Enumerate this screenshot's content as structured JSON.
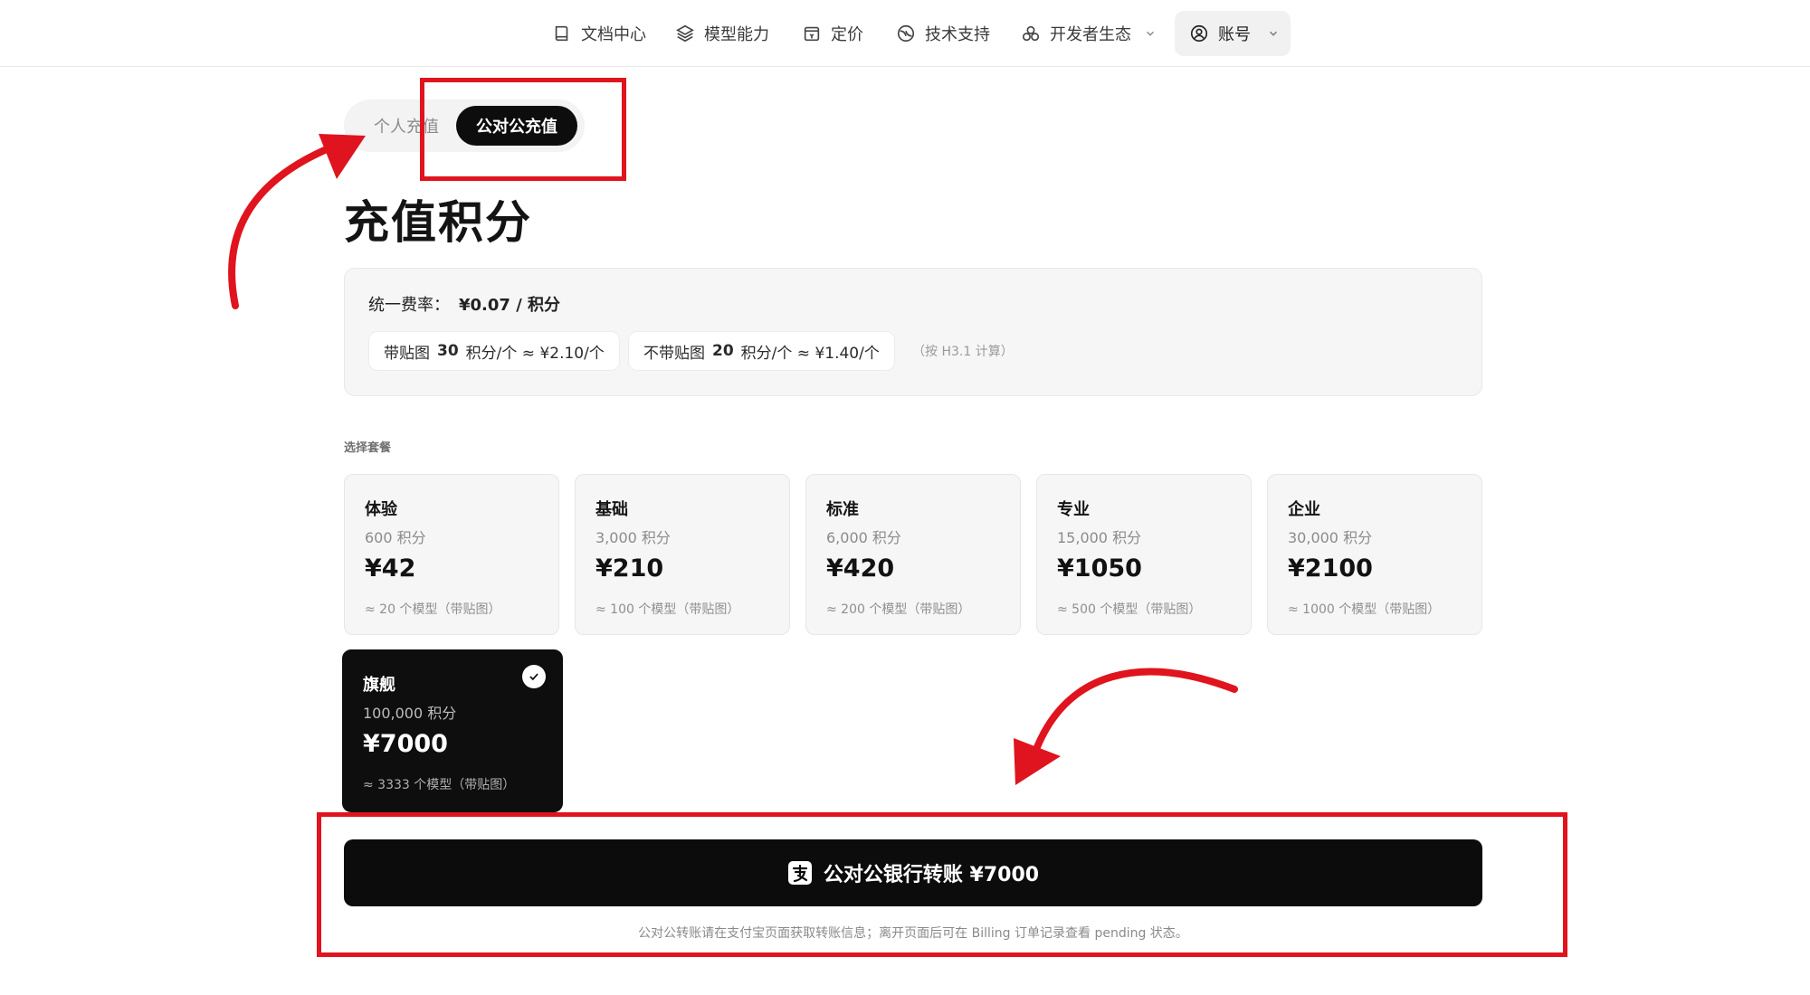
{
  "nav": {
    "items": [
      {
        "label": "文档中心",
        "icon": "book-icon"
      },
      {
        "label": "模型能力",
        "icon": "layers-icon"
      },
      {
        "label": "定价",
        "icon": "price-tag-icon"
      },
      {
        "label": "技术支持",
        "icon": "support-icon"
      },
      {
        "label": "开发者生态",
        "icon": "ecosystem-icon"
      }
    ],
    "account_label": "账号"
  },
  "mode_toggle": {
    "personal_label": "个人充值",
    "corporate_label": "公对公充值",
    "selected": "corporate"
  },
  "page_title": "充值积分",
  "rate": {
    "label": "统一费率：",
    "value": "¥0.07 / 积分",
    "with_sticker_prefix": "带贴图",
    "with_sticker_bold": "30",
    "with_sticker_suffix": "积分/个 ≈ ¥2.10/个",
    "without_sticker_prefix": "不带贴图",
    "without_sticker_bold": "20",
    "without_sticker_suffix": "积分/个 ≈ ¥1.40/个",
    "note": "（按 H3.1 计算）"
  },
  "plans_section_label": "选择套餐",
  "plans": [
    {
      "name": "体验",
      "points": "600 积分",
      "price": "¥42",
      "models": "≈ 20 个模型（带贴图）"
    },
    {
      "name": "基础",
      "points": "3,000 积分",
      "price": "¥210",
      "models": "≈ 100 个模型（带贴图）"
    },
    {
      "name": "标准",
      "points": "6,000 积分",
      "price": "¥420",
      "models": "≈ 200 个模型（带贴图）"
    },
    {
      "name": "专业",
      "points": "15,000 积分",
      "price": "¥1050",
      "models": "≈ 500 个模型（带贴图）"
    },
    {
      "name": "企业",
      "points": "30,000 积分",
      "price": "¥2100",
      "models": "≈ 1000 个模型（带贴图）"
    },
    {
      "name": "旗舰",
      "points": "100,000 积分",
      "price": "¥7000",
      "models": "≈ 3333 个模型（带贴图）",
      "selected": true
    }
  ],
  "pay": {
    "button_label": "公对公银行转账 ¥7000",
    "note": "公对公转账请在支付宝页面获取转账信息；离开页面后可在 Billing 订单记录查看 pending 状态。"
  },
  "colors": {
    "accent": "#0d0d0d",
    "annotation": "#e0141e",
    "card_bg": "#f6f6f6"
  }
}
